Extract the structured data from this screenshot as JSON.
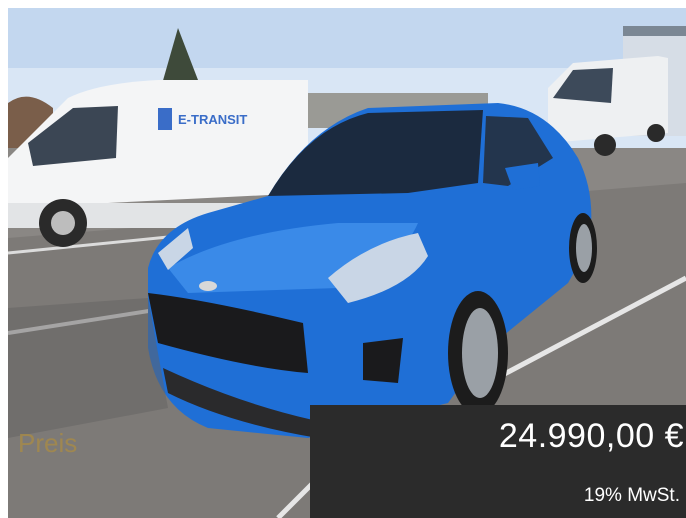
{
  "listing": {
    "image_alt": "Blue compact SUV parked in front of white transit vans",
    "van_logo_text": "E-TRANSIT",
    "price_label": "Preis",
    "price_value": "24.990,00 €",
    "tax_note": "19% MwSt."
  },
  "colors": {
    "car": "#1f6fd6",
    "overlay": "#2b2b2b",
    "label": "#a58a4a"
  }
}
